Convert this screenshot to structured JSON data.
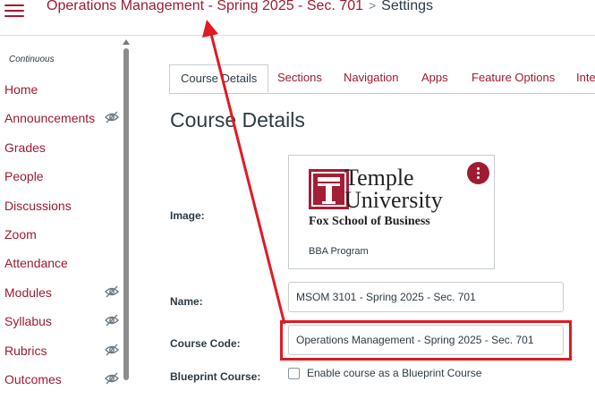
{
  "breadcrumb": {
    "course": "Operations Management - Spring 2025 - Sec. 701",
    "separator": ">",
    "current": "Settings"
  },
  "sidebar": {
    "section_label": "Continuous",
    "items": [
      {
        "label": "Home",
        "hidden": false
      },
      {
        "label": "Announcements",
        "hidden": true
      },
      {
        "label": "Grades",
        "hidden": false
      },
      {
        "label": "People",
        "hidden": false
      },
      {
        "label": "Discussions",
        "hidden": false
      },
      {
        "label": "Zoom",
        "hidden": false
      },
      {
        "label": "Attendance",
        "hidden": false
      },
      {
        "label": "Modules",
        "hidden": true
      },
      {
        "label": "Syllabus",
        "hidden": true
      },
      {
        "label": "Rubrics",
        "hidden": true
      },
      {
        "label": "Outcomes",
        "hidden": true
      }
    ]
  },
  "tabs": [
    {
      "label": "Course Details",
      "active": true
    },
    {
      "label": "Sections",
      "active": false
    },
    {
      "label": "Navigation",
      "active": false
    },
    {
      "label": "Apps",
      "active": false
    },
    {
      "label": "Feature Options",
      "active": false
    },
    {
      "label": "Inte",
      "active": false
    }
  ],
  "page_title": "Course Details",
  "form": {
    "image_label": "Image:",
    "image": {
      "logo_line1": "Temple",
      "logo_line2": "University",
      "logo_subtitle": "Fox School of Business",
      "caption": "BBA Program"
    },
    "name_label": "Name:",
    "name_value": "MSOM 3101 - Spring 2025 - Sec. 701",
    "course_code_label": "Course Code:",
    "course_code_value": "Operations Management - Spring 2025 - Sec. 701",
    "blueprint_label": "Blueprint Course:",
    "blueprint_checkbox_label": "Enable course as a Blueprint Course"
  },
  "colors": {
    "brand": "#9e1b32",
    "annotation": "#e01a22",
    "text": "#2d3b45"
  }
}
